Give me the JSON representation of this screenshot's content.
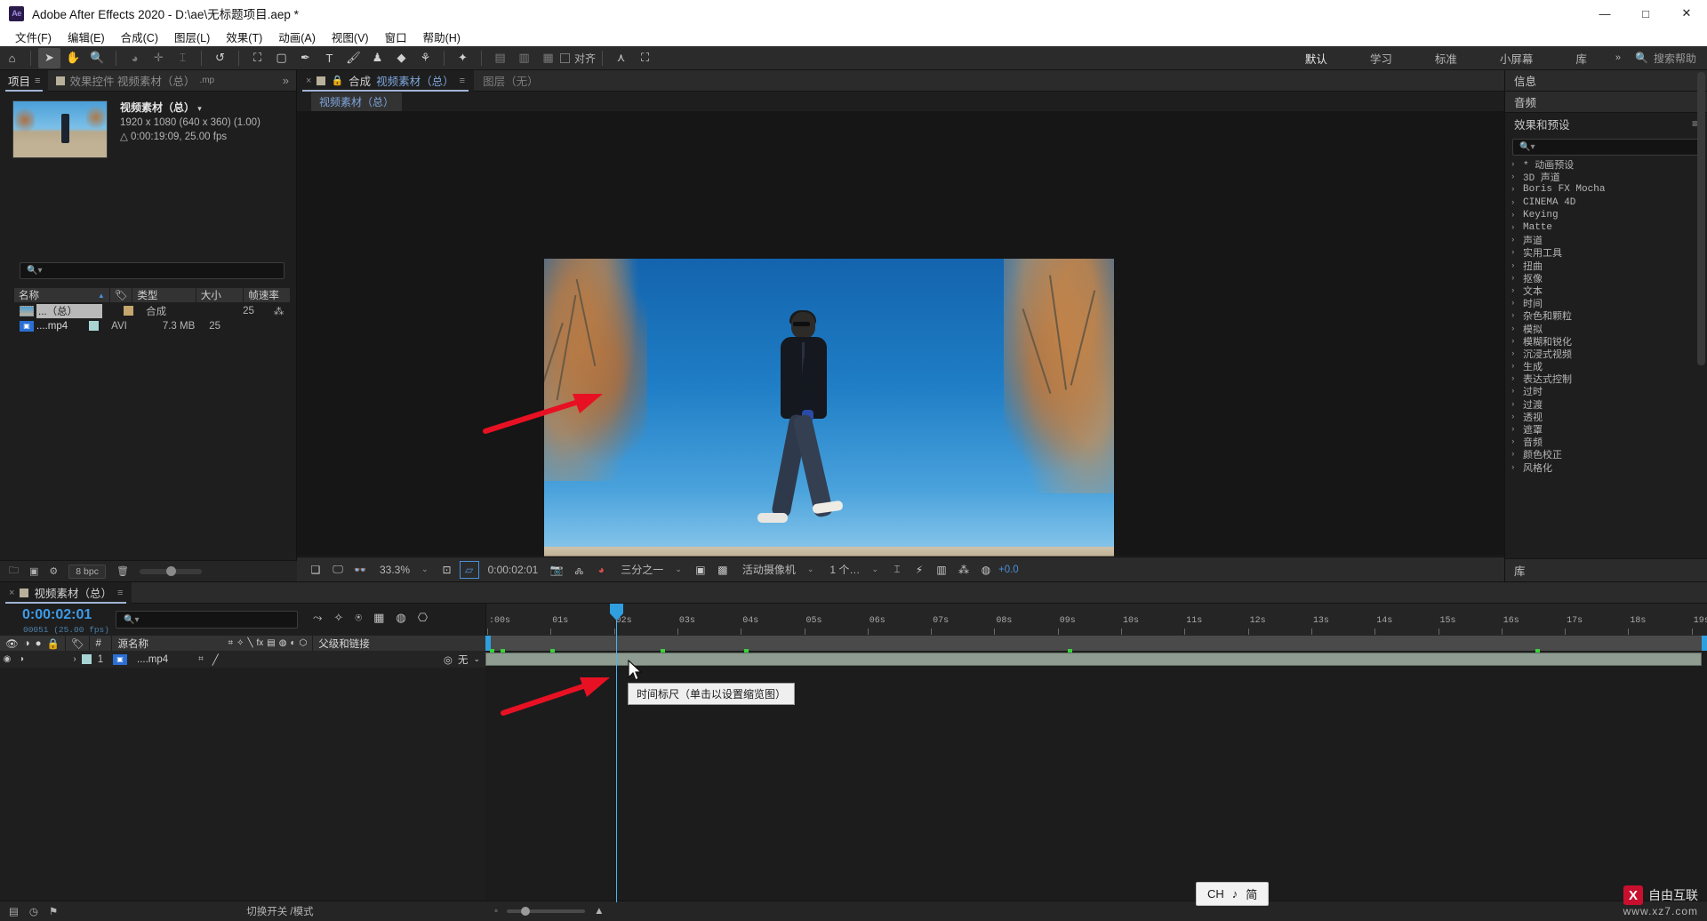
{
  "titlebar": {
    "logo": "Ae",
    "title": "Adobe After Effects 2020 - D:\\ae\\无标题项目.aep *",
    "minimize": "—",
    "maximize": "□",
    "close": "✕"
  },
  "menubar": {
    "items": [
      "文件(F)",
      "编辑(E)",
      "合成(C)",
      "图层(L)",
      "效果(T)",
      "动画(A)",
      "视图(V)",
      "窗口",
      "帮助(H)"
    ]
  },
  "toolbar": {
    "tools": [
      {
        "name": "home-icon",
        "glyph": "⌂"
      },
      {
        "name": "selection-tool-icon",
        "glyph": "➤"
      },
      {
        "name": "hand-tool-icon",
        "glyph": "✋"
      },
      {
        "name": "zoom-tool-icon",
        "glyph": "🔍"
      },
      {
        "name": "orbit-tool-icon",
        "glyph": "◕"
      },
      {
        "name": "pan-behind-tool-icon",
        "glyph": "✛"
      },
      {
        "name": "anchor-point-tool-icon",
        "glyph": "⌶"
      },
      {
        "name": "rotation-tool-icon",
        "glyph": "↺"
      },
      {
        "name": "mask-tool-icon",
        "glyph": "⛶"
      },
      {
        "name": "shape-tool-icon",
        "glyph": "▢"
      },
      {
        "name": "pen-tool-icon",
        "glyph": "✒"
      },
      {
        "name": "type-tool-icon",
        "glyph": "T"
      },
      {
        "name": "brush-tool-icon",
        "glyph": "🖌"
      },
      {
        "name": "clone-stamp-tool-icon",
        "glyph": "♟"
      },
      {
        "name": "eraser-tool-icon",
        "glyph": "◆"
      },
      {
        "name": "roto-brush-tool-icon",
        "glyph": "⚘"
      },
      {
        "name": "puppet-pin-tool-icon",
        "glyph": "✦"
      }
    ],
    "snap_label": "对齐",
    "align_icons": [
      "align-left-icon",
      "align-center-icon",
      "align-right-icon"
    ],
    "extra_icons": [
      "graph-editor-icon",
      "motion-sketch-icon"
    ],
    "workspaces": [
      "默认",
      "学习",
      "标准",
      "小屏幕",
      "库"
    ],
    "workspace_selected": "默认",
    "workspace_chevron": "»",
    "help_search_placeholder": "搜索帮助",
    "help_search_icon": "search-icon"
  },
  "project_panel": {
    "tabs": [
      {
        "label": "项目",
        "selected": true,
        "icon": null
      },
      {
        "label": "效果控件 视频素材（总）",
        "selected": false,
        "icon": "comp-swatch",
        "suffix": ".mp"
      }
    ],
    "overflow": "»",
    "asset": {
      "name": "视频素材（总）",
      "dropdown": "▾",
      "dimensions": "1920 x 1080  (640 x 360) (1.00)",
      "duration": "△ 0:00:19:09, 25.00 fps"
    },
    "search_placeholder": "",
    "search_icon": "search-icon",
    "columns": [
      "名称",
      "类型",
      "大小",
      "帧速率"
    ],
    "tag_column_icon": "tag-icon",
    "sort_indicator": "▲",
    "rows": [
      {
        "name": "...（总）",
        "type": "合成",
        "size": "",
        "fps": "25",
        "selected": true,
        "icon": "comp-thumb-icon",
        "swatch": "tan",
        "extra_icon": "hierarchy-icon"
      },
      {
        "name": "....mp4",
        "type": "AVI",
        "size": "7.3 MB",
        "fps": "25",
        "selected": false,
        "icon": "footage-icon",
        "swatch": "cyan",
        "extra_icon": null
      }
    ],
    "footer": {
      "bpc": "8 bpc",
      "icons": [
        "new-folder-icon",
        "new-comp-icon",
        "project-settings-icon",
        "delete-icon"
      ]
    }
  },
  "comp_panel": {
    "tabs": [
      {
        "close": "×",
        "lock_icon": "lock-icon",
        "prefix": "合成",
        "name": "视频素材（总）",
        "burger": "≡",
        "selected": true
      },
      {
        "label": "图层（无）",
        "selected": false
      }
    ],
    "breadcrumb": "视频素材（总）",
    "bottom_bar": {
      "icons_left": [
        "always-preview-icon",
        "main-viewer-icon",
        "3d-view-icon"
      ],
      "zoom": "33.3%",
      "zoom_chevron": "⌄",
      "resolution_icon": "fit-icon",
      "region_icon": "roi-icon",
      "time": "0:00:02:01",
      "snapshot_icon": "camera-icon",
      "show_snapshot_icon": "show-snapshot-icon",
      "channel_icon": "channels-icon",
      "resolution": "三分之一",
      "resolution_chevron": "⌄",
      "roi_icon": "region-of-interest-icon",
      "transparency_icon": "transparency-grid-icon",
      "camera": "活动摄像机",
      "camera_chevron": "⌄",
      "views": "1 个…",
      "views_chevron": "⌄",
      "guide_icons": [
        "guides-icon",
        "fast-preview-icon",
        "timeline-icon",
        "comp-flowchart-icon"
      ],
      "exposure_icon": "exposure-icon",
      "exposure_value": "+0.0"
    }
  },
  "right_panel": {
    "panels": [
      {
        "label": "信息",
        "selected": false
      },
      {
        "label": "音频",
        "selected": false
      },
      {
        "label": "效果和预设",
        "selected": true,
        "burger": "≡"
      }
    ],
    "search_placeholder": "",
    "search_icon": "search-icon",
    "categories": [
      "* 动画预设",
      "3D 声道",
      "Boris FX Mocha",
      "CINEMA 4D",
      "Keying",
      "Matte",
      "声道",
      "实用工具",
      "扭曲",
      "抠像",
      "文本",
      "时间",
      "杂色和颗粒",
      "模拟",
      "模糊和锐化",
      "沉浸式视频",
      "生成",
      "表达式控制",
      "过时",
      "过渡",
      "透视",
      "遮罩",
      "音频",
      "颜色校正",
      "风格化"
    ],
    "chevron": "›",
    "footer_label": "库"
  },
  "timeline": {
    "tab": {
      "close": "×",
      "swatch_icon": "comp-swatch-icon",
      "label": "视频素材（总）",
      "burger": "≡"
    },
    "current_time": "0:00:02:01",
    "frame_info": "00051 (25.00 fps)",
    "search_placeholder": "",
    "search_icon": "search-icon",
    "control_icons": [
      "composition-mini-flowchart-icon",
      "draft-3d-icon",
      "hide-shy-layers-icon",
      "frame-blending-icon",
      "motion-blur-icon",
      "graph-editor-icon"
    ],
    "columns": {
      "toggles": [
        "eye-icon",
        "audio-icon",
        "solo-icon",
        "lock-icon"
      ],
      "label_icon": "tag-icon",
      "index": "#",
      "source_name": "源名称",
      "switches": [
        "shy-icon",
        "collapse-icon",
        "quality-icon",
        "fx-icon",
        "frame-blend-icon",
        "motion-blur-icon",
        "adjustment-icon",
        "3d-layer-icon"
      ],
      "parent": "父级和链接"
    },
    "layer": {
      "eye": "◉",
      "audio": "◑",
      "expand": "›",
      "index": "1",
      "name": "....mp4",
      "parent_icon": "pickwhip-icon",
      "parent_value": "无",
      "parent_chevron": "⌄"
    },
    "ruler_ticks": [
      ":00s",
      "01s",
      "02s",
      "03s",
      "04s",
      "05s",
      "06s",
      "07s",
      "08s",
      "09s",
      "10s",
      "11s",
      "12s",
      "13s",
      "14s",
      "15s",
      "16s",
      "17s",
      "18s",
      "19s"
    ],
    "tooltip": "时间标尺（单击以设置缩览图）",
    "footer_left": "切换开关 /模式",
    "footer_icons": [
      "toggle-switches-icon",
      "frame-render-icon",
      "comp-render-icon"
    ],
    "zoom_out_icon": "zoom-out-icon",
    "zoom_in_icon": "zoom-in-icon"
  },
  "overlays": {
    "ime_badge": {
      "lang": "CH",
      "music": "♪",
      "mode": "简"
    },
    "watermark": {
      "mark": "X",
      "title": "自由互联",
      "url": "www.xz7.com"
    },
    "annotation_arrows": 2,
    "arrow_color": "#e81123"
  }
}
